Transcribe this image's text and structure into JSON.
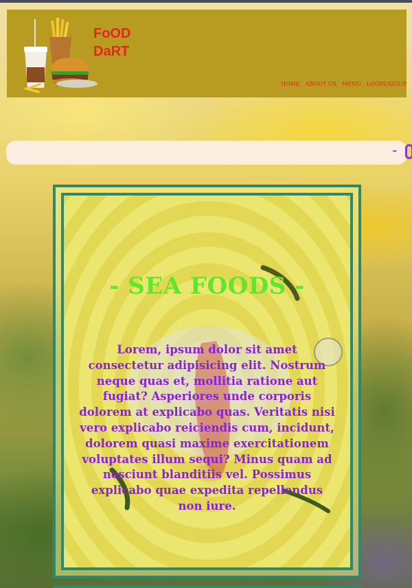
{
  "brand": {
    "line1": "FoOD",
    "line2": "DaRT"
  },
  "nav": [
    "HOME",
    "ABOUT US",
    "MENU",
    "LOGIN/SIGUP"
  ],
  "search": {
    "marker": "-"
  },
  "card": {
    "title": "- SEA FOODS -",
    "text": "Lorem, ipsum dolor sit amet consectetur adipisicing elit. Nostrum neque quas et, mollitia ratione aut fugiat? Asperiores unde corporis dolorem at explicabo quas. Veritatis nisi vero explicabo reiciendis cum, incidunt, dolorem quasi maxime exercitationem voluptates illum sequi? Minus quam ad nesciunt blanditiis vel. Possimus explicabo quae expedita repellendus non iure."
  },
  "colors": {
    "header": "#b89c22",
    "brand": "#e8241b",
    "title": "#5fe82a",
    "text": "#8a22d6",
    "border": "#2b8a6e"
  }
}
